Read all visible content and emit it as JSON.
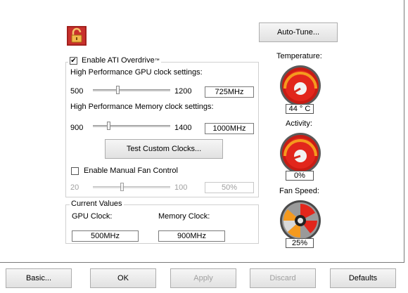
{
  "buttons": {
    "auto_tune": "Auto-Tune...",
    "test_clocks": "Test Custom Clocks...",
    "basic": "Basic...",
    "ok": "OK",
    "apply": "Apply",
    "discard": "Discard",
    "defaults": "Defaults"
  },
  "overdrive": {
    "enable_label": "Enable ATI Overdrive",
    "tm": "™",
    "gpu_heading": "High Performance GPU clock settings:",
    "gpu_min": "500",
    "gpu_max": "1200",
    "gpu_value": "725MHz",
    "gpu_fraction": 0.32,
    "mem_heading": "High Performance Memory clock settings:",
    "mem_min": "900",
    "mem_max": "1400",
    "mem_value": "1000MHz",
    "mem_fraction": 0.2,
    "fan_label": "Enable Manual Fan Control",
    "fan_min": "20",
    "fan_max": "100",
    "fan_value": "50%",
    "fan_fraction": 0.375
  },
  "current": {
    "title": "Current Values",
    "gpu_label": "GPU Clock:",
    "gpu_value": "500MHz",
    "mem_label": "Memory Clock:",
    "mem_value": "900MHz"
  },
  "gauges": {
    "temperature_label": "Temperature:",
    "temperature_value": "44 ° C",
    "activity_label": "Activity:",
    "activity_value": "0%",
    "fan_label": "Fan Speed:",
    "fan_value": "25%"
  },
  "colors": {
    "gauge_red": "#e2261c",
    "gauge_orange": "#f59a1e",
    "fan_grey": "#8a8a8a"
  }
}
